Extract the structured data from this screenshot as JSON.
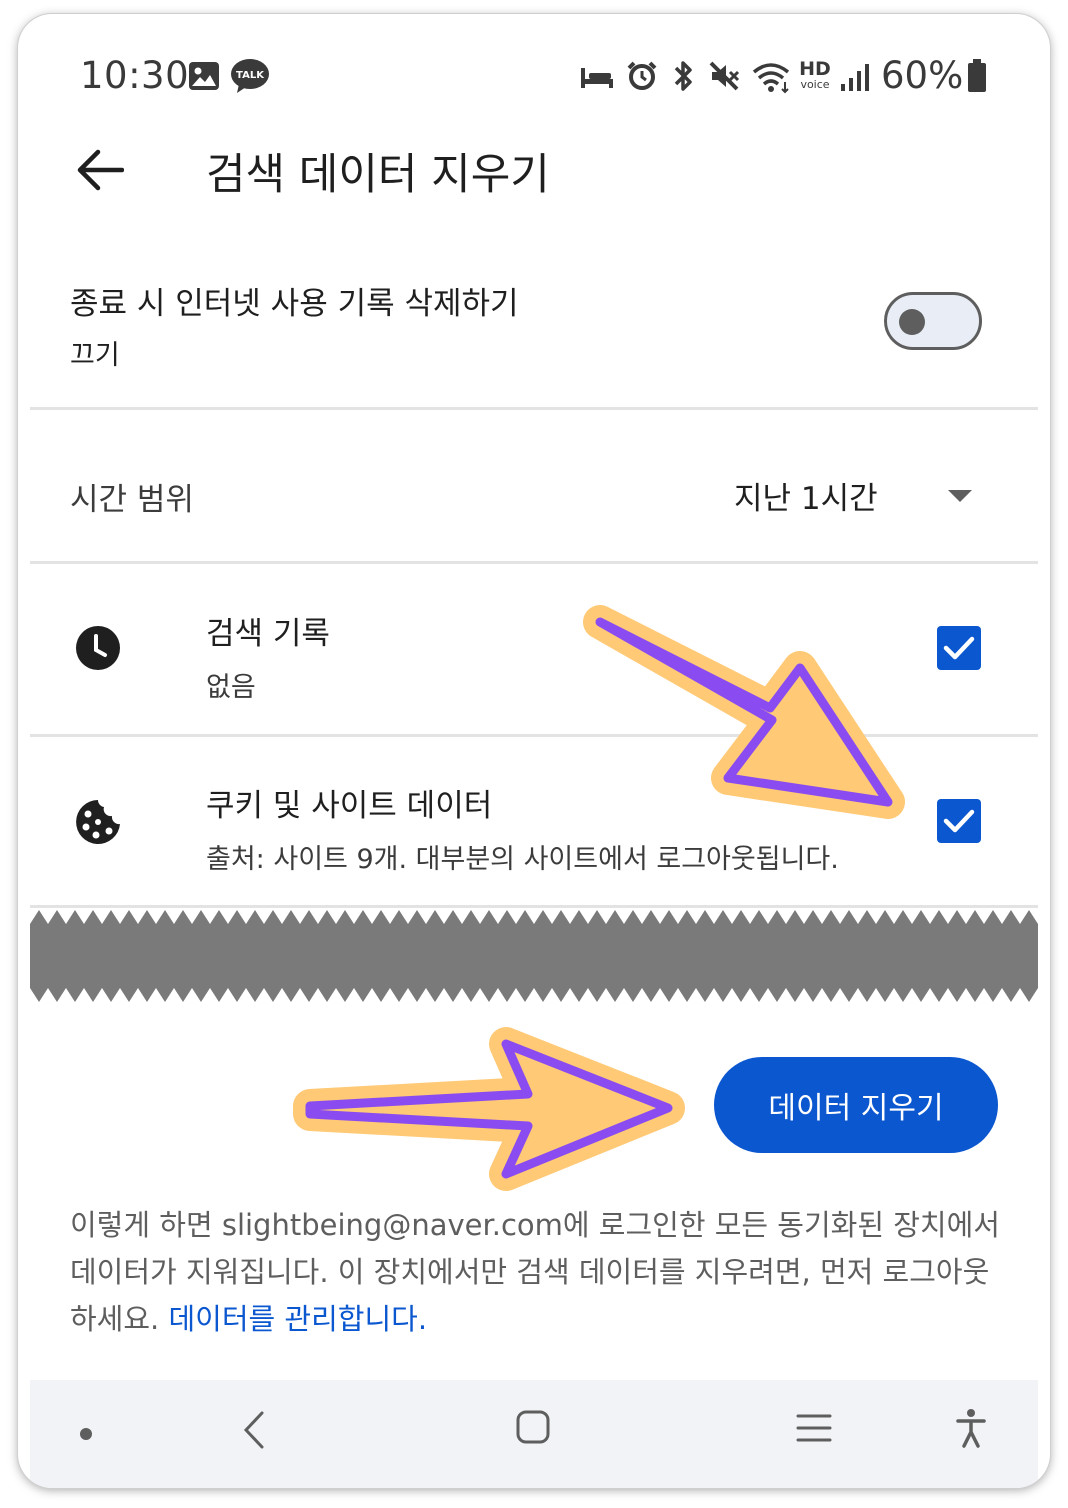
{
  "status_bar": {
    "time": "10:30",
    "battery_percent": "60%",
    "icons": [
      "gallery-icon",
      "kakaotalk-icon",
      "sleep-icon",
      "alarm-icon",
      "bluetooth-icon",
      "mute-icon",
      "wifi-icon",
      "hd-voice-icon",
      "signal-icon",
      "battery-icon"
    ],
    "talk_badge": "TALK",
    "hd_label": "HD",
    "voice_label": "voice"
  },
  "header": {
    "title": "검색 데이터 지우기"
  },
  "auto_delete": {
    "label": "종료 시 인터넷 사용 기록 삭제하기",
    "status": "끄기",
    "enabled": false
  },
  "time_range": {
    "label": "시간 범위",
    "selected": "지난 1시간"
  },
  "items": [
    {
      "title": "검색 기록",
      "subtitle": "없음",
      "checked": true
    },
    {
      "title": "쿠키 및 사이트 데이터",
      "subtitle": "출처: 사이트 9개. 대부분의 사이트에서 로그아웃됩니다.",
      "checked": true
    }
  ],
  "action": {
    "button_label": "데이터 지우기"
  },
  "footer": {
    "text": "이렇게 하면 slightbeing@naver.com에 로그인한 모든 동기화된 장치에서 데이터가 지워집니다. 이 장치에서만 검색 데이터를 지우려면, 먼저 로그아웃하세요. ",
    "link": "데이터를 관리합니다."
  },
  "colors": {
    "accent": "#0b57d0",
    "arrow_fill": "#ffc976",
    "arrow_stroke": "#8a4cf0"
  }
}
